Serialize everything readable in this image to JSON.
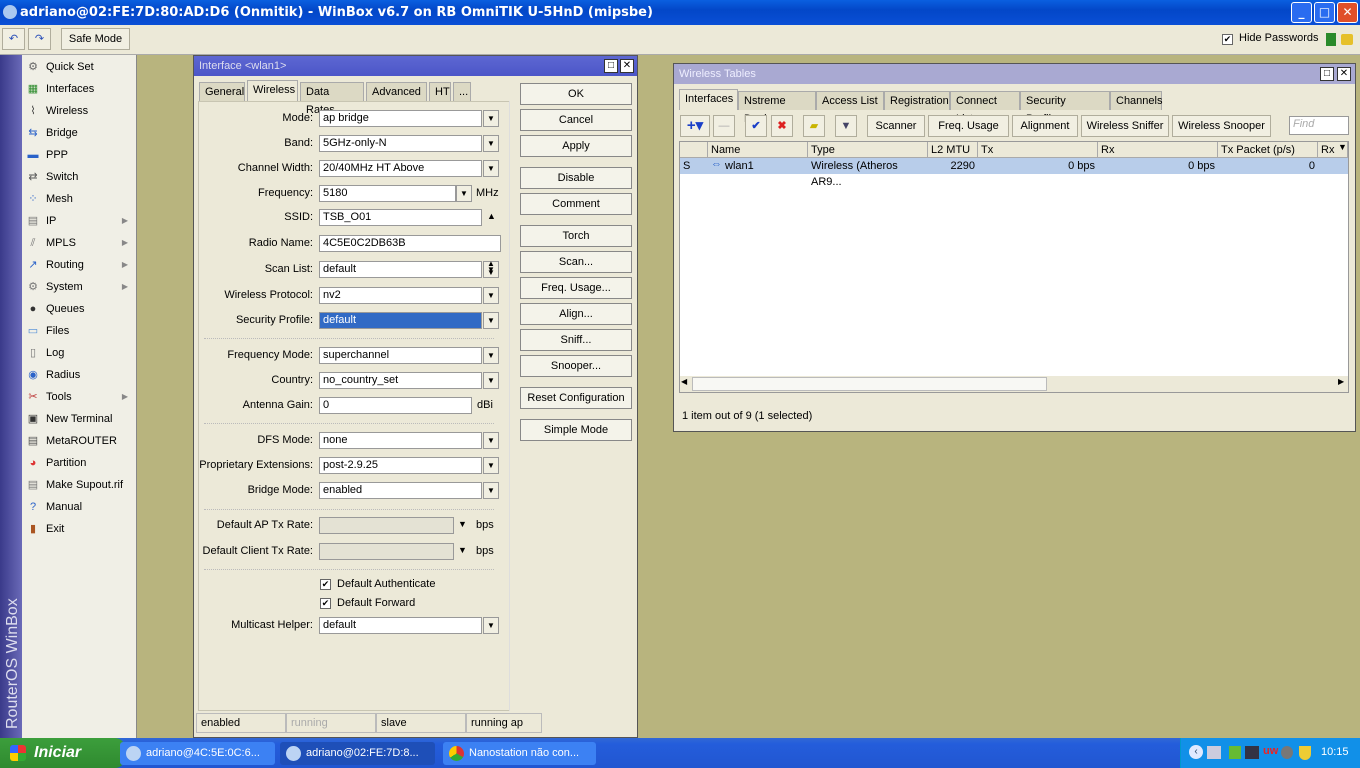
{
  "app": {
    "title": "adriano@02:FE:7D:80:AD:D6 (Onmitik) - WinBox v6.7 on RB OmniTIK U-5HnD (mipsbe)",
    "window_controls": [
      "_",
      "□",
      "✕"
    ]
  },
  "toolbar": {
    "undo": "↶",
    "redo": "↷",
    "safe_mode": "Safe Mode",
    "hide_passwords": "Hide Passwords",
    "hide_passwords_checked": true
  },
  "sidebar": {
    "brand": "RouterOS WinBox",
    "items": [
      {
        "label": "Quick Set",
        "icon": "quick-set-icon",
        "glyph": "⚙",
        "color": "#666"
      },
      {
        "label": "Interfaces",
        "icon": "interfaces-icon",
        "glyph": "▦",
        "color": "#2a8a2a"
      },
      {
        "label": "Wireless",
        "icon": "wireless-icon",
        "glyph": "⌇",
        "color": "#444"
      },
      {
        "label": "Bridge",
        "icon": "bridge-icon",
        "glyph": "⇆",
        "color": "#2a62c9"
      },
      {
        "label": "PPP",
        "icon": "ppp-icon",
        "glyph": "▬",
        "color": "#2a62c9"
      },
      {
        "label": "Switch",
        "icon": "switch-icon",
        "glyph": "⇄",
        "color": "#555"
      },
      {
        "label": "Mesh",
        "icon": "mesh-icon",
        "glyph": "⁘",
        "color": "#2a62c9"
      },
      {
        "label": "IP",
        "icon": "ip-icon",
        "glyph": "▤",
        "color": "#777",
        "sub": true
      },
      {
        "label": "MPLS",
        "icon": "mpls-icon",
        "glyph": "⫽",
        "color": "#777",
        "sub": true
      },
      {
        "label": "Routing",
        "icon": "routing-icon",
        "glyph": "↗",
        "color": "#2a62c9",
        "sub": true
      },
      {
        "label": "System",
        "icon": "system-icon",
        "glyph": "⚙",
        "color": "#777",
        "sub": true
      },
      {
        "label": "Queues",
        "icon": "queues-icon",
        "glyph": "●",
        "color": "#333"
      },
      {
        "label": "Files",
        "icon": "files-icon",
        "glyph": "▭",
        "color": "#4a8ad6"
      },
      {
        "label": "Log",
        "icon": "log-icon",
        "glyph": "▯",
        "color": "#777"
      },
      {
        "label": "Radius",
        "icon": "radius-icon",
        "glyph": "◉",
        "color": "#2a62c9"
      },
      {
        "label": "Tools",
        "icon": "tools-icon",
        "glyph": "✂",
        "color": "#b33",
        "sub": true
      },
      {
        "label": "New Terminal",
        "icon": "terminal-icon",
        "glyph": "▣",
        "color": "#333"
      },
      {
        "label": "MetaROUTER",
        "icon": "metarouter-icon",
        "glyph": "▤",
        "color": "#555"
      },
      {
        "label": "Partition",
        "icon": "partition-icon",
        "glyph": "◕",
        "color": "#d33"
      },
      {
        "label": "Make Supout.rif",
        "icon": "supout-icon",
        "glyph": "▤",
        "color": "#777"
      },
      {
        "label": "Manual",
        "icon": "manual-icon",
        "glyph": "?",
        "color": "#2a62c9"
      },
      {
        "label": "Exit",
        "icon": "exit-icon",
        "glyph": "▮",
        "color": "#a52"
      }
    ]
  },
  "interface_window": {
    "title": "Interface <wlan1>",
    "tabs": [
      "General",
      "Wireless",
      "Data Rates",
      "Advanced",
      "HT",
      "..."
    ],
    "active_tab": 1,
    "fields": {
      "mode": {
        "label": "Mode:",
        "value": "ap bridge"
      },
      "band": {
        "label": "Band:",
        "value": "5GHz-only-N"
      },
      "channel_width": {
        "label": "Channel Width:",
        "value": "20/40MHz HT Above"
      },
      "frequency": {
        "label": "Frequency:",
        "value": "5180",
        "unit": "MHz"
      },
      "ssid": {
        "label": "SSID:",
        "value": "TSB_O01"
      },
      "radio_name": {
        "label": "Radio Name:",
        "value": "4C5E0C2DB63B"
      },
      "scan_list": {
        "label": "Scan List:",
        "value": "default"
      },
      "wireless_protocol": {
        "label": "Wireless Protocol:",
        "value": "nv2"
      },
      "security_profile": {
        "label": "Security Profile:",
        "value": "default"
      },
      "frequency_mode": {
        "label": "Frequency Mode:",
        "value": "superchannel"
      },
      "country": {
        "label": "Country:",
        "value": "no_country_set"
      },
      "antenna_gain": {
        "label": "Antenna Gain:",
        "value": "0",
        "unit": "dBi"
      },
      "dfs_mode": {
        "label": "DFS Mode:",
        "value": "none"
      },
      "proprietary_extensions": {
        "label": "Proprietary Extensions:",
        "value": "post-2.9.25"
      },
      "bridge_mode": {
        "label": "Bridge Mode:",
        "value": "enabled"
      },
      "default_ap_tx_rate": {
        "label": "Default AP Tx Rate:",
        "value": "",
        "unit": "bps"
      },
      "default_client_tx_rate": {
        "label": "Default Client Tx Rate:",
        "value": "",
        "unit": "bps"
      },
      "multicast_helper": {
        "label": "Multicast Helper:",
        "value": "default"
      }
    },
    "checkboxes": [
      {
        "label": "Default Authenticate",
        "checked": true
      },
      {
        "label": "Default Forward",
        "checked": true
      }
    ],
    "buttons": [
      "OK",
      "Cancel",
      "Apply",
      "Disable",
      "Comment",
      "Torch",
      "Scan...",
      "Freq. Usage...",
      "Align...",
      "Sniff...",
      "Snooper...",
      "Reset Configuration",
      "Simple Mode"
    ],
    "status": [
      "enabled",
      "running",
      "slave",
      "running ap"
    ]
  },
  "wireless_tables": {
    "title": "Wireless Tables",
    "tabs": [
      "Interfaces",
      "Nstreme Dual",
      "Access List",
      "Registration",
      "Connect List",
      "Security Profiles",
      "Channels"
    ],
    "toolbar": [
      "Scanner",
      "Freq. Usage",
      "Alignment",
      "Wireless Sniffer",
      "Wireless Snooper"
    ],
    "find_placeholder": "Find",
    "columns": [
      "",
      "Name",
      "Type",
      "L2 MTU",
      "Tx",
      "Rx",
      "Tx Packet (p/s)",
      "Rx"
    ],
    "rows": [
      {
        "flag": "S",
        "name": "wlan1",
        "type": "Wireless (Atheros AR9...",
        "l2mtu": "2290",
        "tx": "0 bps",
        "rx": "0 bps",
        "tx_packet": "0"
      }
    ],
    "status": "1 item out of 9 (1 selected)"
  },
  "taskbar": {
    "start": "Iniciar",
    "tasks": [
      "adriano@4C:5E:0C:6...",
      "adriano@02:FE:7D:8...",
      "Nanostation não con..."
    ],
    "clock": "10:15"
  }
}
